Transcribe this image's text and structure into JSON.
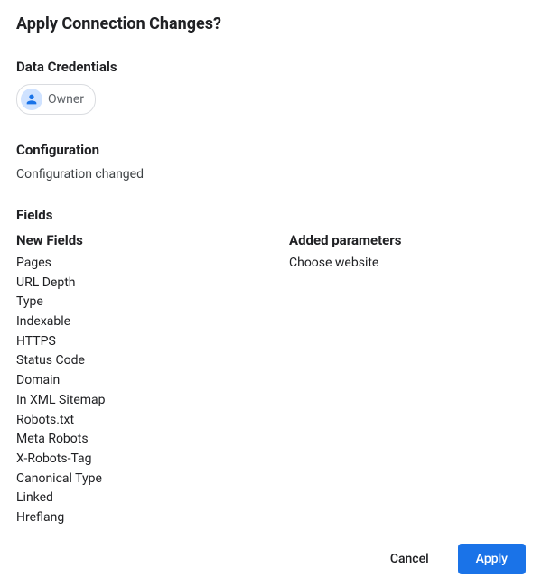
{
  "dialog": {
    "title": "Apply Connection Changes?"
  },
  "credentials": {
    "heading": "Data Credentials",
    "owner_label": "Owner"
  },
  "configuration": {
    "heading": "Configuration",
    "status": "Configuration changed"
  },
  "fields": {
    "heading": "Fields",
    "new_fields_heading": "New Fields",
    "added_params_heading": "Added parameters",
    "new_fields": [
      "Pages",
      "URL Depth",
      "Type",
      "Indexable",
      "HTTPS",
      "Status Code",
      "Domain",
      "In XML Sitemap",
      "Robots.txt",
      "Meta Robots",
      "X-Robots-Tag",
      "Canonical Type",
      "Linked",
      "Hreflang"
    ],
    "added_parameters": [
      "Choose website"
    ]
  },
  "buttons": {
    "cancel": "Cancel",
    "apply": "Apply"
  }
}
